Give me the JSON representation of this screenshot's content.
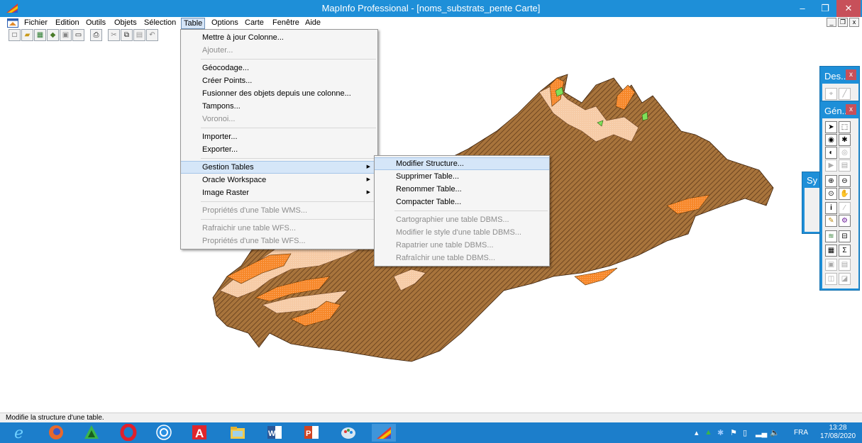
{
  "window": {
    "title": "MapInfo Professional - [noms_substrats_pente Carte]",
    "min_glyph": "–",
    "max_glyph": "❐",
    "close_glyph": "✕"
  },
  "menubar": {
    "items": [
      "Fichier",
      "Edition",
      "Outils",
      "Objets",
      "Sélection",
      "Table",
      "Options",
      "Carte",
      "Fenêtre",
      "Aide"
    ],
    "active_index": 5,
    "mdi_controls": [
      "_",
      "❐",
      "x"
    ]
  },
  "menu_table": {
    "items": [
      {
        "label": "Mettre à jour Colonne...",
        "enabled": true
      },
      {
        "label": "Ajouter...",
        "enabled": false
      },
      {
        "label": "Géocodage...",
        "enabled": true
      },
      {
        "label": "Créer Points...",
        "enabled": true
      },
      {
        "label": "Fusionner des objets depuis une colonne...",
        "enabled": true
      },
      {
        "label": "Tampons...",
        "enabled": true
      },
      {
        "label": "Voronoi...",
        "enabled": false
      },
      {
        "label": "Importer...",
        "enabled": true
      },
      {
        "label": "Exporter...",
        "enabled": true
      },
      {
        "label": "Gestion Tables",
        "enabled": true
      },
      {
        "label": "Oracle Workspace",
        "enabled": true
      },
      {
        "label": "Image Raster",
        "enabled": true
      },
      {
        "label": "Propriétés d'une Table WMS...",
        "enabled": false
      },
      {
        "label": "Rafraichir une table WFS...",
        "enabled": false
      },
      {
        "label": "Propriétés d'une Table WFS...",
        "enabled": false
      }
    ]
  },
  "menu_gestion": {
    "items": [
      {
        "label": "Modifier Structure...",
        "enabled": true
      },
      {
        "label": "Supprimer Table...",
        "enabled": true
      },
      {
        "label": "Renommer Table...",
        "enabled": true
      },
      {
        "label": "Compacter Table...",
        "enabled": true
      },
      {
        "label": "Cartographier une table DBMS...",
        "enabled": false
      },
      {
        "label": "Modifier le style d'une table DBMS...",
        "enabled": false
      },
      {
        "label": "Rapatrier une table DBMS...",
        "enabled": false
      },
      {
        "label": "Rafraîchir une table DBMS...",
        "enabled": false
      }
    ]
  },
  "palettes": {
    "dessin_title": "Des...",
    "general_title": "Gén...",
    "symbol_title": "Sy",
    "close_glyph": "x"
  },
  "statusbar": {
    "text": "Modifie la structure d'une table."
  },
  "taskbar": {
    "lang": "FRA",
    "time": "13:28",
    "date": "17/08/2020"
  },
  "colors": {
    "titlebar": "#1e8fd8",
    "taskbar": "#1c7ecb",
    "close": "#c7505a",
    "substrate_brown": "#a8743c",
    "substrate_orange": "#f7882a",
    "substrate_peach": "#f6cba6",
    "substrate_green": "#7fe05a"
  }
}
